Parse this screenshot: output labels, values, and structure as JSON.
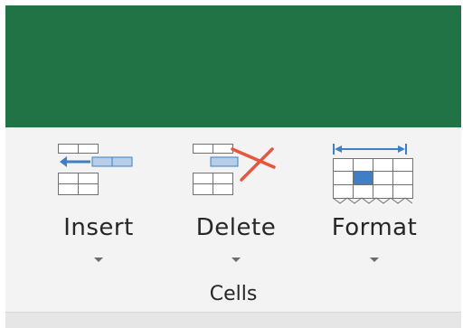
{
  "ribbon": {
    "commands": [
      {
        "label": "Insert",
        "icon": "insert-cells-icon"
      },
      {
        "label": "Delete",
        "icon": "delete-cells-icon"
      },
      {
        "label": "Format",
        "icon": "format-cells-icon"
      }
    ],
    "group_label": "Cells"
  },
  "colors": {
    "title_bar": "#217346",
    "ribbon_background": "#f3f3f3",
    "icon_accent": "#3f7fc5",
    "delete_x": "#e8553e"
  }
}
